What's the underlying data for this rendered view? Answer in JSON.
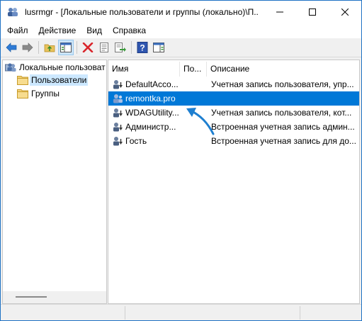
{
  "window": {
    "title": "lusrmgr - [Локальные пользователи и группы (локально)\\П..."
  },
  "menu": [
    "Файл",
    "Действие",
    "Вид",
    "Справка"
  ],
  "tree": {
    "root": "Локальные пользоват",
    "children": [
      "Пользователи",
      "Группы"
    ],
    "selected_child": "Пользователи"
  },
  "list": {
    "columns": [
      "Имя",
      "По...",
      "Описание"
    ],
    "rows": [
      {
        "name": "DefaultAcco...",
        "full": "",
        "description": "Учетная запись пользователя, упр..."
      },
      {
        "name": "remontka.pro",
        "full": "",
        "description": ""
      },
      {
        "name": "WDAGUtility...",
        "full": "",
        "description": "Учетная запись пользователя, кот..."
      },
      {
        "name": "Администр...",
        "full": "",
        "description": "Встроенная учетная запись админ..."
      },
      {
        "name": "Гость",
        "full": "",
        "description": "Встроенная учетная запись для до..."
      }
    ],
    "selected_row": "remontka.pro"
  },
  "colors": {
    "selection": "#0078d7",
    "tree_selection": "#cce8ff",
    "annotation_arrow": "#1e7fd0"
  },
  "icons": {
    "toolbar": [
      "back-arrow-icon",
      "forward-arrow-icon",
      "up-folder-icon",
      "show-hide-tree-icon",
      "delete-icon",
      "properties-icon",
      "export-list-icon",
      "help-icon",
      "show-action-pane-icon"
    ]
  }
}
